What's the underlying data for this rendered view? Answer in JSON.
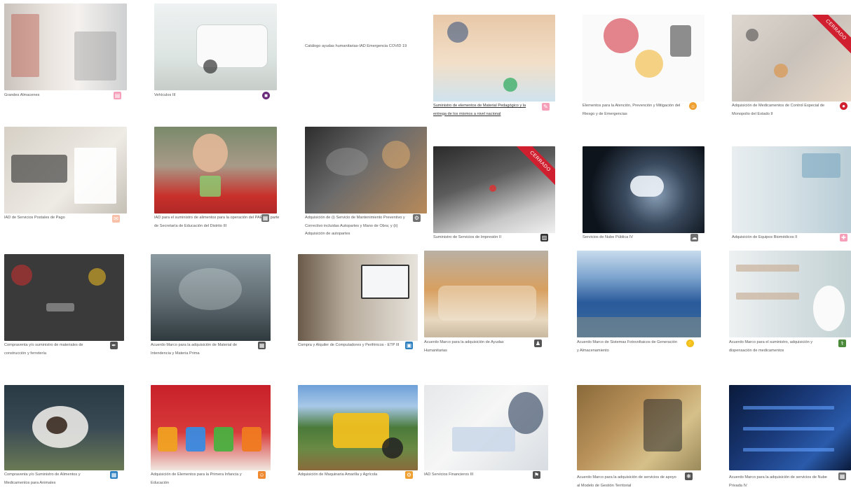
{
  "cards": [
    {
      "caption": "Grandes Almacenes",
      "icon": "shopping-bag-icon",
      "ribbon": ""
    },
    {
      "caption": "Vehículos III",
      "icon": "car-icon",
      "ribbon": ""
    },
    {
      "caption": "Catálogo ayudas humanitarias-IAD Emergencia COVID 19",
      "icon": "",
      "ribbon": ""
    },
    {
      "caption": "Suministro de elementos de Material Pedagógico y la entrega de los mismos a nivel nacional",
      "icon": "pencil-icon",
      "ribbon": ""
    },
    {
      "caption": "Elementos para la Atención, Prevención y Mitigación del Riesgo y de Emergencias",
      "icon": "warning-sun-icon",
      "ribbon": ""
    },
    {
      "caption": "Adquisición de Medicamentos de Control Especial de Monopolio del Estado II",
      "icon": "pill-icon",
      "ribbon": "CERRADO"
    },
    {
      "caption": "IAD de Servicios Postales de Pago",
      "icon": "envelope-icon",
      "ribbon": ""
    },
    {
      "caption": "IAD para el suministro de alimentos para la operación del PAE por parte de Secretaría de Educación del Distrito III",
      "icon": "lunchbox-icon",
      "ribbon": ""
    },
    {
      "caption": "Adquisición de (i) Servicio de Mantenimiento Preventivo y Correctivo incluidas Autopartes y Mano de Obra; y (ii) Adquisición de autopartes",
      "icon": "engine-icon",
      "ribbon": ""
    },
    {
      "caption": "Suministro de Servicios de Impresión II",
      "icon": "printer-icon",
      "ribbon": "CERRADO"
    },
    {
      "caption": "Servicios de Nube Pública IV",
      "icon": "cloud-lock-icon",
      "ribbon": ""
    },
    {
      "caption": "Adquisición de Equipos Biomédicos II",
      "icon": "medical-case-icon",
      "ribbon": ""
    },
    {
      "caption": "Compraventa y/o suministro de materiales de construcción y ferretería",
      "icon": "hammer-icon",
      "ribbon": ""
    },
    {
      "caption": "Acuerdo Marco para la adquisición de Material de Intendencia y Materia Prima",
      "icon": "building-icon",
      "ribbon": ""
    },
    {
      "caption": "Compra y Alquiler de Computadores y Periféricos - ETP III",
      "icon": "computer-icon",
      "ribbon": ""
    },
    {
      "caption": "Acuerdo Marco para la adquisición de Ayudas Humanitarias",
      "icon": "people-icon",
      "ribbon": ""
    },
    {
      "caption": "Acuerdo Marco de Sistemas Fotovoltaicos de Generación y Almacenamiento",
      "icon": "solar-bolt-icon",
      "ribbon": ""
    },
    {
      "caption": "Acuerdo Marco para el suministro, adquisición y dispensación de medicamentos",
      "icon": "pharmacist-icon",
      "ribbon": ""
    },
    {
      "caption": "Compraventa y/o Suministro de Alimentos y Medicamentos para Animales",
      "icon": "animal-feed-icon",
      "ribbon": ""
    },
    {
      "caption": "Adquisición de Elementos para la Primera Infancia y Educación",
      "icon": "child-icon",
      "ribbon": ""
    },
    {
      "caption": "Adquisición de Maquinaria Amarilla y Agrícola",
      "icon": "tractor-icon",
      "ribbon": ""
    },
    {
      "caption": "IAD Servicios Financieros III",
      "icon": "bank-icon",
      "ribbon": ""
    },
    {
      "caption": "Acuerdo Marco para la adquisición de servicios de apoyo al Modelo de Gestión Territorial",
      "icon": "network-icon",
      "ribbon": ""
    },
    {
      "caption": "Acuerdo Marco para la adquisición de servicios de Nube Privada IV",
      "icon": "server-icon",
      "ribbon": ""
    }
  ],
  "colors": {
    "badge_purple": "#6a2a7a",
    "badge_red": "#d0202f",
    "badge_orange": "#f0a030",
    "badge_pink": "#f5a0b8",
    "badge_grey": "#707070",
    "badge_blue": "#2c80c0",
    "badge_green": "#4a8a3a",
    "ribbon": "#d0202f"
  }
}
